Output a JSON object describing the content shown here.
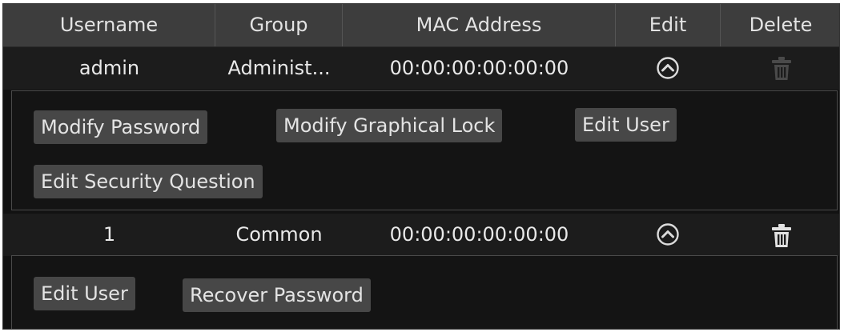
{
  "columns": {
    "username": "Username",
    "group": "Group",
    "mac": "MAC Address",
    "edit": "Edit",
    "delete": "Delete"
  },
  "users": [
    {
      "username": "admin",
      "group": "Administ...",
      "mac": "00:00:00:00:00:00",
      "edit_icon": "chevron-up-circle-icon",
      "delete_icon": "trash-icon",
      "delete_enabled": false,
      "actions": {
        "modify_password": "Modify Password",
        "modify_graphical_lock": "Modify Graphical Lock",
        "edit_user": "Edit User",
        "edit_security_question": "Edit Security Question"
      }
    },
    {
      "username": "1",
      "group": "Common",
      "mac": "00:00:00:00:00:00",
      "edit_icon": "chevron-up-circle-icon",
      "delete_icon": "trash-icon",
      "delete_enabled": true,
      "actions": {
        "edit_user": "Edit User",
        "recover_password": "Recover Password"
      }
    }
  ],
  "colors": {
    "background": "#121212",
    "header": "#3d3d3d",
    "row": "#1c1c1c",
    "button": "#474747",
    "text": "#e8e8e8",
    "disabled_icon": "#4a4a4a"
  }
}
